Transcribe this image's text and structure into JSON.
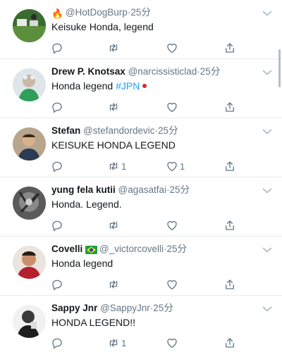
{
  "tweets": [
    {
      "emoji": "🔥",
      "name": "",
      "handle": "@HotDogBurp",
      "time": "25分",
      "text": "Keisuke Honda, legend",
      "retweets": "",
      "likes": ""
    },
    {
      "emoji": "",
      "name": "Drew P. Knotsax",
      "handle": "@narcissisticlad",
      "time": "25分",
      "text": "Honda legend ",
      "hashtag": "#JPN",
      "retweets": "",
      "likes": ""
    },
    {
      "emoji": "",
      "name": "Stefan",
      "handle": "@stefandordevic",
      "time": "25分",
      "text": "KEISUKE HONDA LEGEND",
      "retweets": "1",
      "likes": "1"
    },
    {
      "emoji": "",
      "name": "yung fela kutii",
      "handle": "@agasatfai",
      "time": "25分",
      "text": "Honda. Legend.",
      "retweets": "",
      "likes": ""
    },
    {
      "emoji": "",
      "name": "Covelli",
      "handle": "@_victorcovelli",
      "time": "25分",
      "text": "Honda legend",
      "retweets": "",
      "likes": ""
    },
    {
      "emoji": "",
      "name": "Sappy Jnr",
      "handle": "@SappyJnr",
      "time": "25分",
      "text": "HONDA LEGEND!!",
      "retweets": "1",
      "likes": ""
    }
  ],
  "separator": "·",
  "colors": {
    "accent": "#1da1f2",
    "secondary_text": "#657786",
    "divider": "#e6ecf0",
    "icon": "#657786"
  }
}
